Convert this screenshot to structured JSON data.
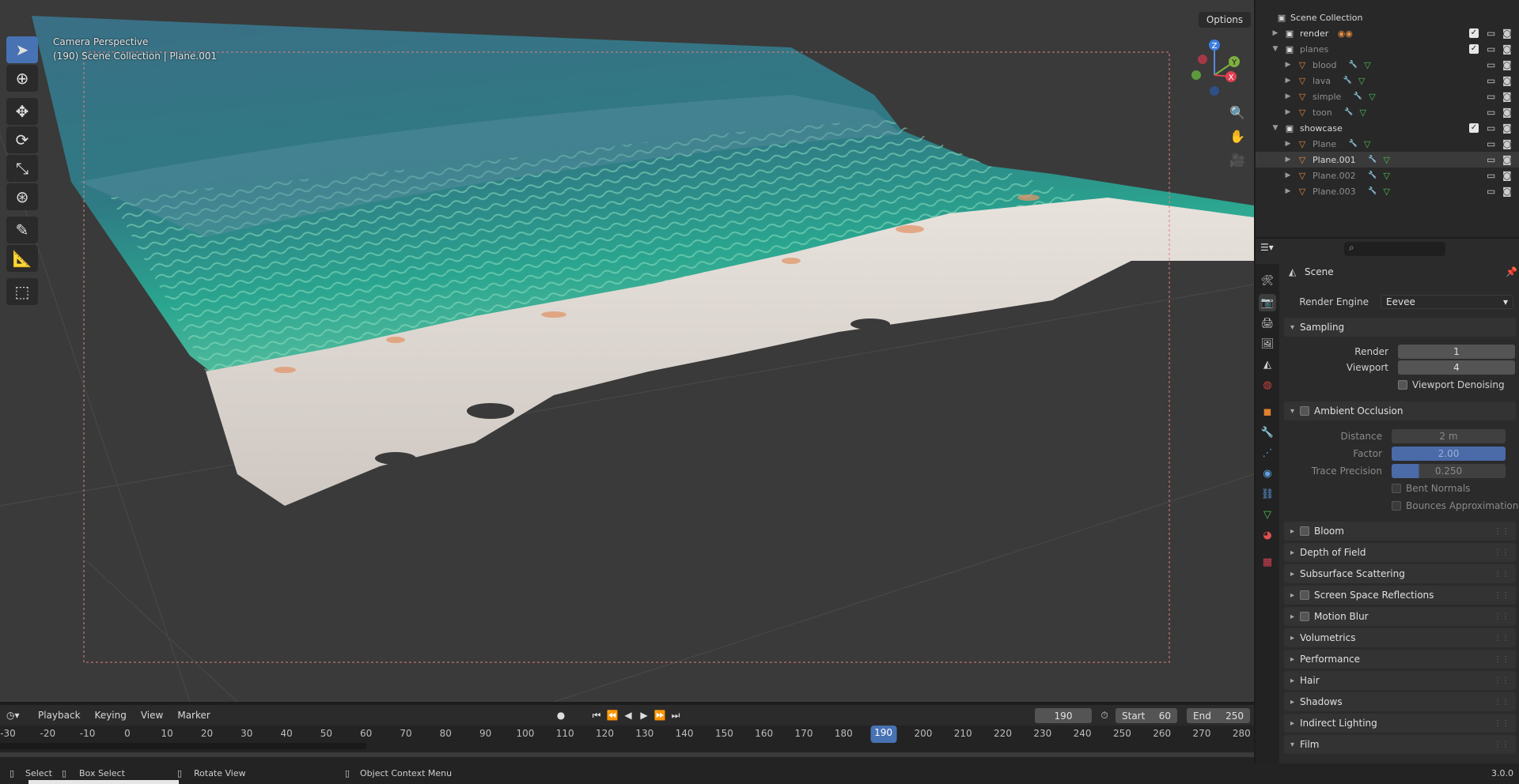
{
  "viewport": {
    "perspective_label": "Camera Perspective",
    "collection_label": "(190) Scene Collection | Plane.001",
    "options_label": "Options"
  },
  "timeline": {
    "menus": [
      "Playback",
      "Keying",
      "View",
      "Marker"
    ],
    "current_frame": "190",
    "start_label": "Start",
    "start_value": "60",
    "end_label": "End",
    "end_value": "250",
    "ticks": [
      "-30",
      "-20",
      "-10",
      "0",
      "10",
      "20",
      "30",
      "40",
      "50",
      "60",
      "70",
      "80",
      "90",
      "100",
      "110",
      "120",
      "130",
      "140",
      "150",
      "160",
      "170",
      "180",
      "190",
      "200",
      "210",
      "220",
      "230",
      "240",
      "250",
      "260",
      "270",
      "280"
    ],
    "playhead": "190"
  },
  "statusbar": {
    "select": "Select",
    "box_select": "Box Select",
    "rotate_view": "Rotate View",
    "context_menu": "Object Context Menu",
    "version": "3.0.0"
  },
  "outliner": {
    "root": "Scene Collection",
    "items": [
      {
        "label": "render",
        "kind": "collection"
      },
      {
        "label": "planes",
        "kind": "collection"
      },
      {
        "label": "blood",
        "kind": "object"
      },
      {
        "label": "lava",
        "kind": "object"
      },
      {
        "label": "simple",
        "kind": "object"
      },
      {
        "label": "toon",
        "kind": "object"
      },
      {
        "label": "showcase",
        "kind": "collection"
      },
      {
        "label": "Plane",
        "kind": "object"
      },
      {
        "label": "Plane.001",
        "kind": "object",
        "selected": true
      },
      {
        "label": "Plane.002",
        "kind": "object"
      },
      {
        "label": "Plane.003",
        "kind": "object"
      }
    ]
  },
  "properties": {
    "context": "Scene",
    "render_engine_label": "Render Engine",
    "render_engine_value": "Eevee",
    "sampling": {
      "title": "Sampling",
      "render_label": "Render",
      "render_value": "1",
      "viewport_label": "Viewport",
      "viewport_value": "4",
      "denoise_label": "Viewport Denoising"
    },
    "ao": {
      "title": "Ambient Occlusion",
      "distance_label": "Distance",
      "distance_value": "2 m",
      "factor_label": "Factor",
      "factor_value": "2.00",
      "trace_label": "Trace Precision",
      "trace_value": "0.250",
      "bent_label": "Bent Normals",
      "bounces_label": "Bounces Approximation"
    },
    "panels": [
      "Bloom",
      "Depth of Field",
      "Subsurface Scattering",
      "Screen Space Reflections",
      "Motion Blur",
      "Volumetrics",
      "Performance",
      "Hair",
      "Shadows",
      "Indirect Lighting",
      "Film"
    ]
  }
}
